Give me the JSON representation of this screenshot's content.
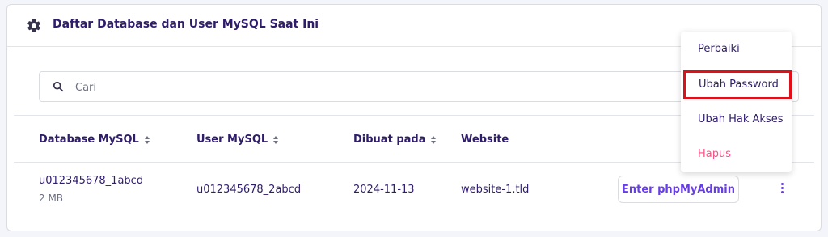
{
  "card": {
    "title": "Daftar Database dan User MySQL Saat Ini",
    "icon": "gear-icon"
  },
  "search": {
    "placeholder": "Cari",
    "value": "",
    "icon": "search-icon"
  },
  "table": {
    "headers": [
      "Database MySQL",
      "User MySQL",
      "Dibuat pada",
      "Website"
    ],
    "sortable": [
      true,
      true,
      true,
      false
    ],
    "rows": [
      {
        "database": "u012345678_1abcd",
        "size": "2 MB",
        "user": "u012345678_2abcd",
        "created": "2024-11-13",
        "website": "website-1.tld",
        "action_label": "Enter phpMyAdmin"
      }
    ]
  },
  "menu": {
    "items": [
      "Perbaiki",
      "Ubah Password",
      "Ubah Hak Akses",
      "Hapus"
    ],
    "highlighted": "Ubah Password",
    "highlight_color": "#e0101a",
    "danger_color": "#fc5185"
  },
  "colors": {
    "primary": "#673de6",
    "text": "#2f1c6a",
    "muted": "#6d7081"
  }
}
